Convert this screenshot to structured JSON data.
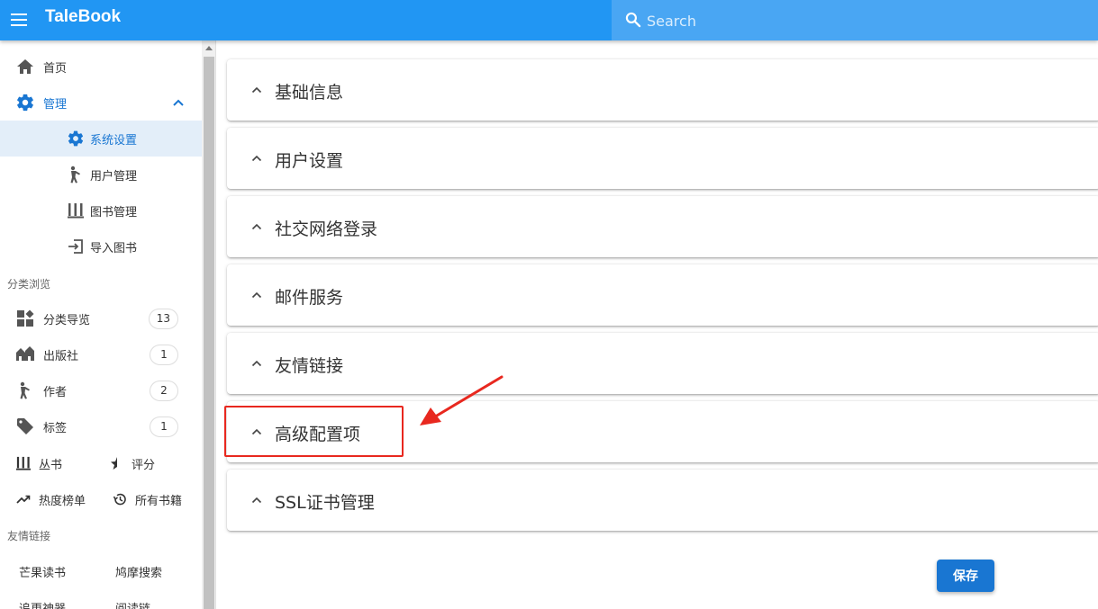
{
  "header": {
    "title": "TaleBook",
    "search_placeholder": "Search"
  },
  "sidebar": {
    "items": [
      {
        "label": "首页",
        "icon": "home-icon"
      },
      {
        "label": "管理",
        "icon": "gear-icon",
        "expanded": true
      },
      {
        "label": "系统设置",
        "icon": "gear-icon",
        "active": true
      },
      {
        "label": "用户管理",
        "icon": "person-icon"
      },
      {
        "label": "图书管理",
        "icon": "books-icon"
      },
      {
        "label": "导入图书",
        "icon": "import-icon"
      }
    ],
    "browse_section_label": "分类浏览",
    "browse_items": [
      {
        "label": "分类导览",
        "count": "13",
        "icon": "category-icon"
      },
      {
        "label": "出版社",
        "count": "1",
        "icon": "publisher-icon"
      },
      {
        "label": "作者",
        "count": "2",
        "icon": "person-icon"
      },
      {
        "label": "标签",
        "count": "1",
        "icon": "tag-icon"
      }
    ],
    "extra_items": [
      {
        "label": "丛书",
        "icon": "books-icon"
      },
      {
        "label": "评分",
        "icon": "star-half-icon"
      },
      {
        "label": "热度榜单",
        "icon": "trending-icon"
      },
      {
        "label": "所有书籍",
        "icon": "history-icon"
      }
    ],
    "links_section_label": "友情链接",
    "links": [
      "芒果读书",
      "鸠摩搜索",
      "追更神器",
      "阅读链"
    ]
  },
  "panels": [
    {
      "title": "基础信息"
    },
    {
      "title": "用户设置"
    },
    {
      "title": "社交网络登录"
    },
    {
      "title": "邮件服务"
    },
    {
      "title": "友情链接"
    },
    {
      "title": "高级配置项",
      "highlighted": true
    },
    {
      "title": "SSL证书管理"
    }
  ],
  "save_label": "保存",
  "colors": {
    "primary": "#2196f3",
    "search_bg": "#49a6f3",
    "active_bg": "#e3eef9",
    "active_text": "#1976d2",
    "button": "#1976d2",
    "highlight": "#e8281f"
  }
}
